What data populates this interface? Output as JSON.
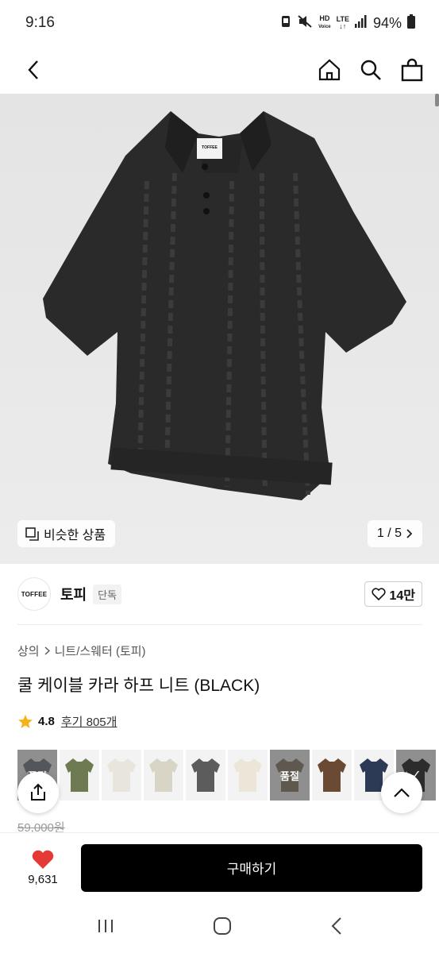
{
  "status": {
    "time": "9:16",
    "hd": "HD",
    "voice": "Voice",
    "lte": "LTE",
    "battery": "94%"
  },
  "nav": {
    "back_icon": "chevron-left-icon",
    "home_icon": "home-icon",
    "search_icon": "search-icon",
    "cart_icon": "shopping-bag-icon"
  },
  "hero": {
    "image_label": "TOFFEE",
    "similar_label": "비슷한 상품",
    "pager": "1 / 5"
  },
  "brand": {
    "logo_text": "TOFFEE",
    "name": "토피",
    "tag": "단독",
    "likes": "14만"
  },
  "breadcrumb": {
    "cat1": "상의",
    "cat2": "니트/스웨터 (토피)"
  },
  "product": {
    "title": "쿨 케이블 카라 하프 니트 (BLACK)",
    "rating": "4.8",
    "reviews": "후기 805개",
    "price_original": "59,000원"
  },
  "swatches": [
    {
      "color": "#6f7680",
      "soldout": true,
      "label": "품절"
    },
    {
      "color": "#6e7a52",
      "soldout": false,
      "label": ""
    },
    {
      "color": "#e8e5dc",
      "soldout": false,
      "label": ""
    },
    {
      "color": "#d9d5c6",
      "soldout": false,
      "label": ""
    },
    {
      "color": "#5c5c5c",
      "soldout": false,
      "label": ""
    },
    {
      "color": "#ebe6d8",
      "soldout": false,
      "label": ""
    },
    {
      "color": "#8a7a66",
      "soldout": true,
      "label": "품절"
    },
    {
      "color": "#6a4a32",
      "soldout": false,
      "label": ""
    },
    {
      "color": "#2c3a55",
      "soldout": false,
      "label": ""
    },
    {
      "color": "#1a1a1a",
      "soldout": false,
      "label": "",
      "selected": true
    }
  ],
  "bottom": {
    "wish_count": "9,631",
    "buy_label": "구매하기"
  },
  "colors": {
    "heart": "#e53935",
    "star": "#f5b21b",
    "accent": "#000000"
  }
}
